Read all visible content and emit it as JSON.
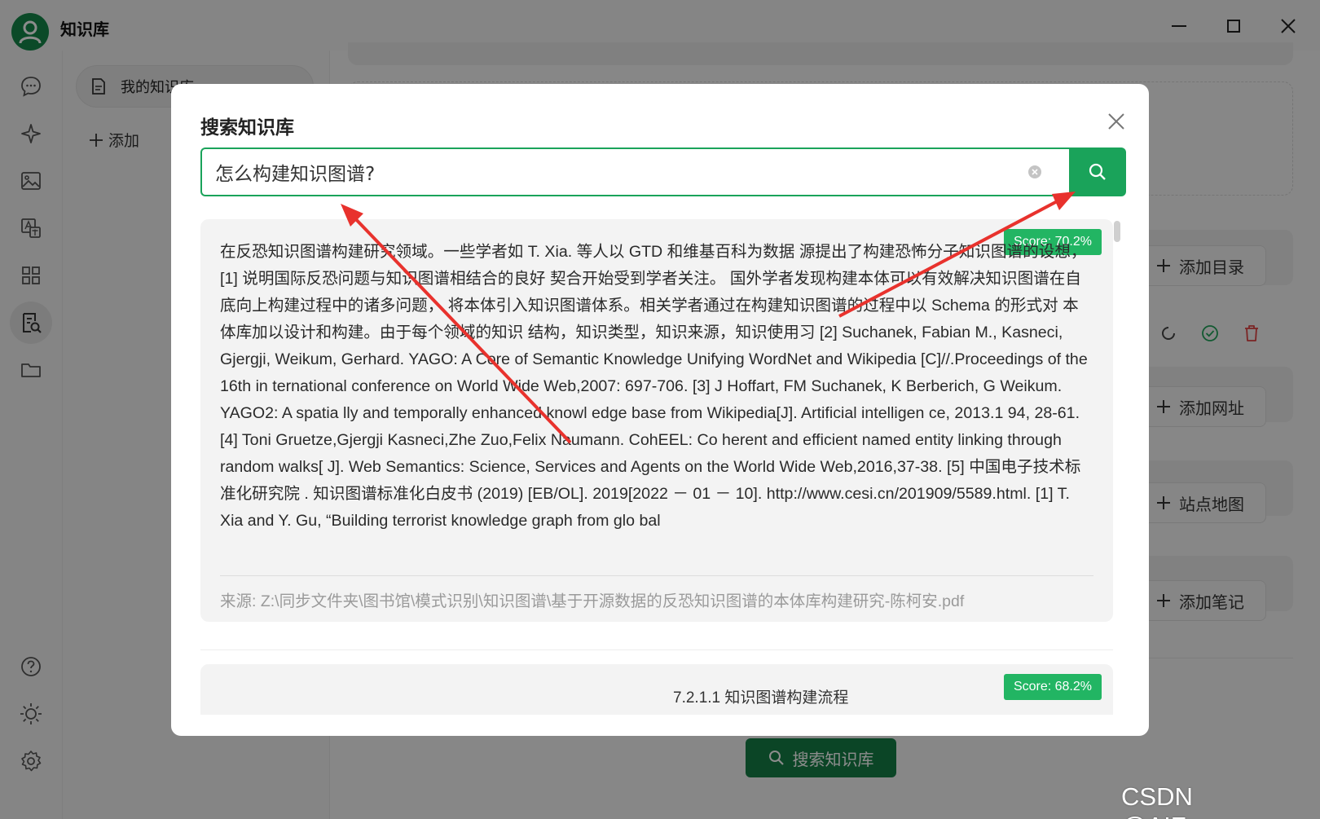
{
  "app": {
    "title": "知识库"
  },
  "sidebar": {
    "knowledge_base_item": "我的知识库",
    "add_label": "添加"
  },
  "main": {
    "add_directory": "添加目录",
    "add_url": "添加网址",
    "add_sitemap": "站点地图",
    "add_note": "添加笔记",
    "search_button": "搜索知识库"
  },
  "dialog": {
    "title": "搜索知识库",
    "query": "怎么构建知识图谱?",
    "results": [
      {
        "score": "Score: 70.2%",
        "text": "在反恐知识图谱构建研究领域。一些学者如 T. Xia. 等人以 GTD 和维基百科为数据 源提出了构建恐怖分子知识图谱的设想，  [1] 说明国际反恐问题与知识图谱相结合的良好 契合开始受到学者关注。 国外学者发现构建本体可以有效解决知识图谱在自底向上构建过程中的诸多问题， 将本体引入知识图谱体系。相关学者通过在构建知识图谱的过程中以 Schema 的形式对 本体库加以设计和构建。由于每个领域的知识 结构，知识类型，知识来源，知识使用习 [2] Suchanek, Fabian M., Kasneci, Gjergji, Weikum, Gerhard. YAGO: A Core of Semantic Knowledge Unifying WordNet and Wikipedia [C]//.Proceedings of the 16th in ternational conference on World Wide Web,2007: 697-706. [3] J Hoffart, FM Suchanek, K Berberich, G Weikum. YAGO2: A spatia lly and temporally enhanced knowl edge base from Wikipedia[J]. Artificial intelligen ce, 2013.1 94, 28-61. [4] Toni Gruetze,Gjergji Kasneci,Zhe Zuo,Felix Naumann. CohEEL: Co herent and efficient named entity linking through random walks[ J]. Web Semantics: Science, Services and Agents on the World Wide Web,2016,37-38. [5] 中国电子技术标准化研究院 . 知识图谱标准化白皮书 (2019) [EB/OL]. 2019[2022 － 01 － 10]. http://www.cesi.cn/201909/5589.html. [1] T. Xia and Y. Gu, “Building terrorist knowledge graph from glo bal",
        "source": "来源: Z:\\同步文件夹\\图书馆\\模式识别\\知识图谱\\基于开源数据的反恐知识图谱的本体库构建研究-陈柯安.pdf"
      },
      {
        "score": "Score: 68.2%",
        "text": "7.2.1.1 知识图谱构建流程"
      }
    ]
  },
  "watermark": "CSDN @AIFarmer",
  "colors": {
    "brand": "#1aa35a",
    "brand_dark": "#157f45",
    "score_badge": "#22b563",
    "arrow": "#e8322d",
    "delete": "#e04040"
  }
}
